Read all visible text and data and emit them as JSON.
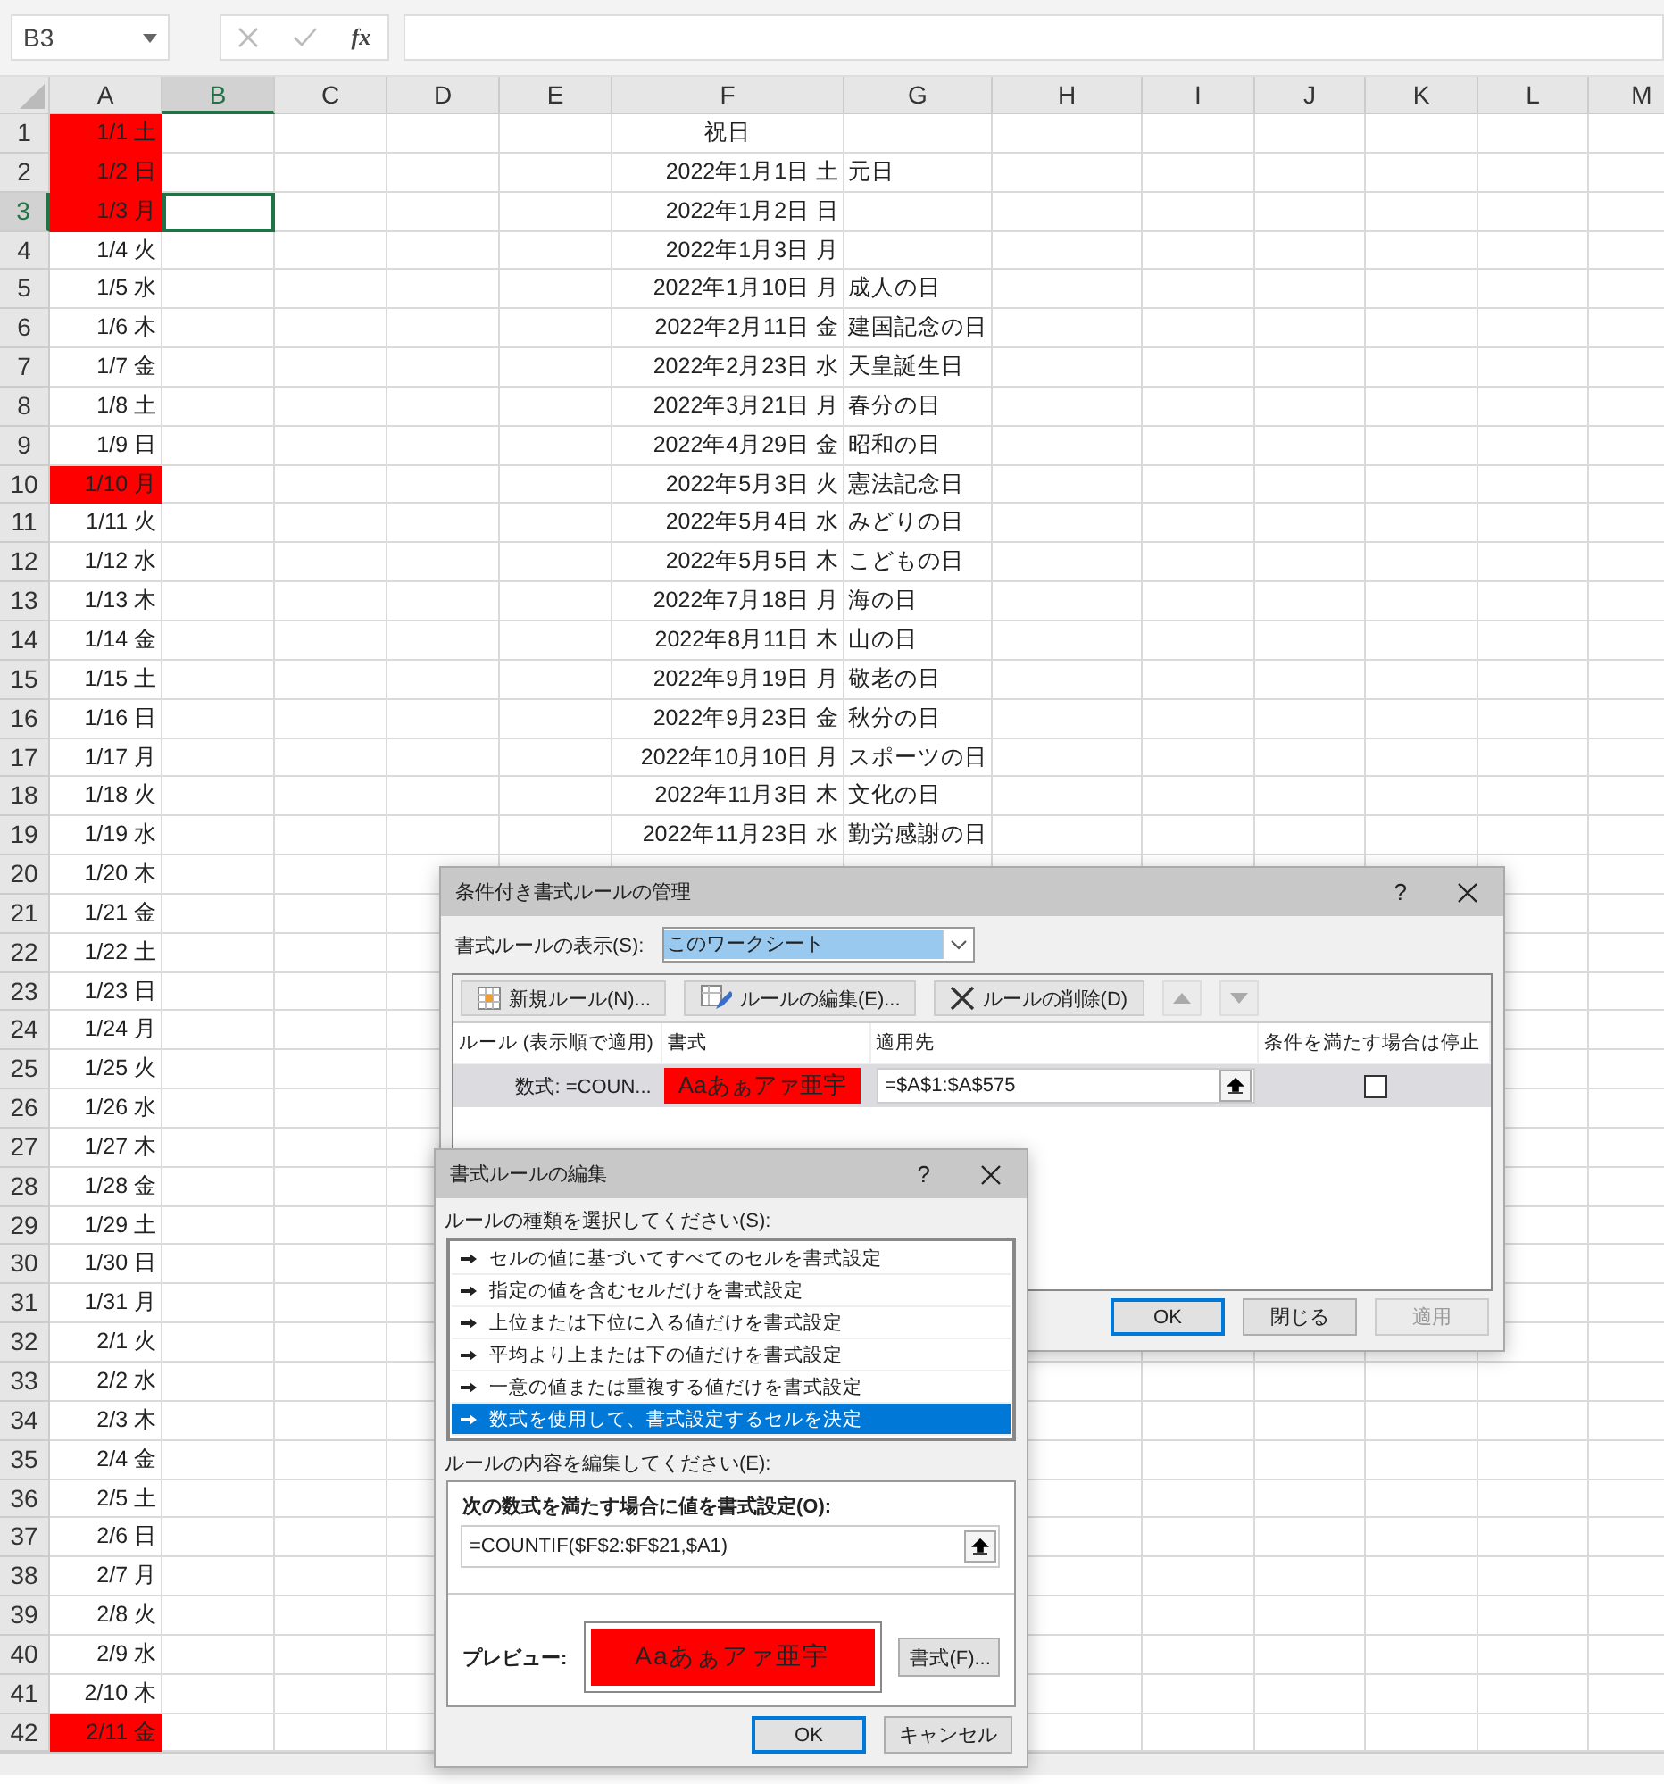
{
  "name_box": "B3",
  "formula_bar": {
    "function_label": "fx"
  },
  "columns": [
    {
      "label": "A",
      "selected": false
    },
    {
      "label": "B",
      "selected": true
    },
    {
      "label": "C",
      "selected": false
    },
    {
      "label": "D",
      "selected": false
    },
    {
      "label": "E",
      "selected": false
    },
    {
      "label": "F",
      "selected": false
    },
    {
      "label": "G",
      "selected": false
    },
    {
      "label": "H",
      "selected": false
    },
    {
      "label": "I",
      "selected": false
    },
    {
      "label": "J",
      "selected": false
    },
    {
      "label": "K",
      "selected": false
    },
    {
      "label": "L",
      "selected": false
    },
    {
      "label": "M",
      "selected": false
    }
  ],
  "rows": [
    {
      "number": "1",
      "selected": false,
      "a": "1/1 土",
      "highlighted": true,
      "f": "祝日"
    },
    {
      "number": "2",
      "selected": false,
      "a": "1/2 日",
      "highlighted": true,
      "f": "2022年1月1日 土",
      "g": "元日"
    },
    {
      "number": "3",
      "selected": true,
      "a": "1/3 月",
      "highlighted": true,
      "f": "2022年1月2日 日"
    },
    {
      "number": "4",
      "selected": false,
      "a": "1/4 火",
      "highlighted": false,
      "f": "2022年1月3日 月"
    },
    {
      "number": "5",
      "selected": false,
      "a": "1/5 水",
      "highlighted": false,
      "f": "2022年1月10日 月",
      "g": "成人の日"
    },
    {
      "number": "6",
      "selected": false,
      "a": "1/6 木",
      "highlighted": false,
      "f": "2022年2月11日 金",
      "g": "建国記念の日"
    },
    {
      "number": "7",
      "selected": false,
      "a": "1/7 金",
      "highlighted": false,
      "f": "2022年2月23日 水",
      "g": "天皇誕生日"
    },
    {
      "number": "8",
      "selected": false,
      "a": "1/8 土",
      "highlighted": false,
      "f": "2022年3月21日 月",
      "g": "春分の日"
    },
    {
      "number": "9",
      "selected": false,
      "a": "1/9 日",
      "highlighted": false,
      "f": "2022年4月29日 金",
      "g": "昭和の日"
    },
    {
      "number": "10",
      "selected": false,
      "a": "1/10 月",
      "highlighted": true,
      "f": "2022年5月3日 火",
      "g": "憲法記念日"
    },
    {
      "number": "11",
      "selected": false,
      "a": "1/11 火",
      "highlighted": false,
      "f": "2022年5月4日 水",
      "g": "みどりの日"
    },
    {
      "number": "12",
      "selected": false,
      "a": "1/12 水",
      "highlighted": false,
      "f": "2022年5月5日 木",
      "g": "こどもの日"
    },
    {
      "number": "13",
      "selected": false,
      "a": "1/13 木",
      "highlighted": false,
      "f": "2022年7月18日 月",
      "g": "海の日"
    },
    {
      "number": "14",
      "selected": false,
      "a": "1/14 金",
      "highlighted": false,
      "f": "2022年8月11日 木",
      "g": "山の日"
    },
    {
      "number": "15",
      "selected": false,
      "a": "1/15 土",
      "highlighted": false,
      "f": "2022年9月19日 月",
      "g": "敬老の日"
    },
    {
      "number": "16",
      "selected": false,
      "a": "1/16 日",
      "highlighted": false,
      "f": "2022年9月23日 金",
      "g": "秋分の日"
    },
    {
      "number": "17",
      "selected": false,
      "a": "1/17 月",
      "highlighted": false,
      "f": "2022年10月10日 月",
      "g": "スポーツの日"
    },
    {
      "number": "18",
      "selected": false,
      "a": "1/18 火",
      "highlighted": false,
      "f": "2022年11月3日 木",
      "g": "文化の日"
    },
    {
      "number": "19",
      "selected": false,
      "a": "1/19 水",
      "highlighted": false,
      "f": "2022年11月23日 水",
      "g": "勤労感謝の日"
    },
    {
      "number": "20",
      "selected": false,
      "a": "1/20 木",
      "highlighted": false
    },
    {
      "number": "21",
      "selected": false,
      "a": "1/21 金",
      "highlighted": false
    },
    {
      "number": "22",
      "selected": false,
      "a": "1/22 土",
      "highlighted": false
    },
    {
      "number": "23",
      "selected": false,
      "a": "1/23 日",
      "highlighted": false
    },
    {
      "number": "24",
      "selected": false,
      "a": "1/24 月",
      "highlighted": false
    },
    {
      "number": "25",
      "selected": false,
      "a": "1/25 火",
      "highlighted": false
    },
    {
      "number": "26",
      "selected": false,
      "a": "1/26 水",
      "highlighted": false
    },
    {
      "number": "27",
      "selected": false,
      "a": "1/27 木",
      "highlighted": false
    },
    {
      "number": "28",
      "selected": false,
      "a": "1/28 金",
      "highlighted": false
    },
    {
      "number": "29",
      "selected": false,
      "a": "1/29 土",
      "highlighted": false
    },
    {
      "number": "30",
      "selected": false,
      "a": "1/30 日",
      "highlighted": false
    },
    {
      "number": "31",
      "selected": false,
      "a": "1/31 月",
      "highlighted": false
    },
    {
      "number": "32",
      "selected": false,
      "a": "2/1 火",
      "highlighted": false
    },
    {
      "number": "33",
      "selected": false,
      "a": "2/2 水",
      "highlighted": false
    },
    {
      "number": "34",
      "selected": false,
      "a": "2/3 木",
      "highlighted": false
    },
    {
      "number": "35",
      "selected": false,
      "a": "2/4 金",
      "highlighted": false
    },
    {
      "number": "36",
      "selected": false,
      "a": "2/5 土",
      "highlighted": false
    },
    {
      "number": "37",
      "selected": false,
      "a": "2/6 日",
      "highlighted": false
    },
    {
      "number": "38",
      "selected": false,
      "a": "2/7 月",
      "highlighted": false
    },
    {
      "number": "39",
      "selected": false,
      "a": "2/8 火",
      "highlighted": false
    },
    {
      "number": "40",
      "selected": false,
      "a": "2/9 水",
      "highlighted": false
    },
    {
      "number": "41",
      "selected": false,
      "a": "2/10 木",
      "highlighted": false
    },
    {
      "number": "42",
      "selected": false,
      "a": "2/11 金",
      "highlighted": true
    }
  ],
  "manager_dialog": {
    "title": "条件付き書式ルールの管理",
    "help": "?",
    "show_label": "書式ルールの表示(S):",
    "show_value": "このワークシート",
    "toolbar": [
      {
        "kind": "new",
        "label": "新規ルール(N)...",
        "disabled": false
      },
      {
        "kind": "edit",
        "label": "ルールの編集(E)...",
        "disabled": false
      },
      {
        "kind": "delete",
        "label": "ルールの削除(D)",
        "disabled": false
      },
      {
        "kind": "up",
        "disabled": true
      },
      {
        "kind": "down",
        "disabled": true
      }
    ],
    "columns": [
      "ルール (表示順で適用)",
      "書式",
      "適用先",
      "条件を満たす場合は停止"
    ],
    "rules": [
      {
        "rule": "数式: =COUN...",
        "format_preview": "Aaあぁアァ亜宇",
        "applies_to": "=$A$1:$A$575",
        "stop_if_true": false,
        "selected": true
      }
    ],
    "buttons": [
      {
        "label": "OK",
        "default": true,
        "disabled": false
      },
      {
        "label": "閉じる",
        "default": false,
        "disabled": false
      },
      {
        "label": "適用",
        "default": false,
        "disabled": true
      }
    ]
  },
  "edit_dialog": {
    "title": "書式ルールの編集",
    "help": "?",
    "type_label": "ルールの種類を選択してください(S):",
    "rule_types": [
      {
        "label": "セルの値に基づいてすべてのセルを書式設定",
        "selected": false
      },
      {
        "label": "指定の値を含むセルだけを書式設定",
        "selected": false
      },
      {
        "label": "上位または下位に入る値だけを書式設定",
        "selected": false
      },
      {
        "label": "平均より上または下の値だけを書式設定",
        "selected": false
      },
      {
        "label": "一意の値または重複する値だけを書式設定",
        "selected": false
      },
      {
        "label": "数式を使用して、書式設定するセルを決定",
        "selected": true
      }
    ],
    "edit_label": "ルールの内容を編集してください(E):",
    "formula_label": "次の数式を満たす場合に値を書式設定(O):",
    "formula": "=COUNTIF($F$2:$F$21,$A1)",
    "preview_label": "プレビュー:",
    "preview": "Aaあぁアァ亜宇",
    "format_button": "書式(F)...",
    "buttons": [
      {
        "label": "OK",
        "default": true,
        "disabled": false
      },
      {
        "label": "キャンセル",
        "default": false,
        "disabled": false
      }
    ]
  }
}
